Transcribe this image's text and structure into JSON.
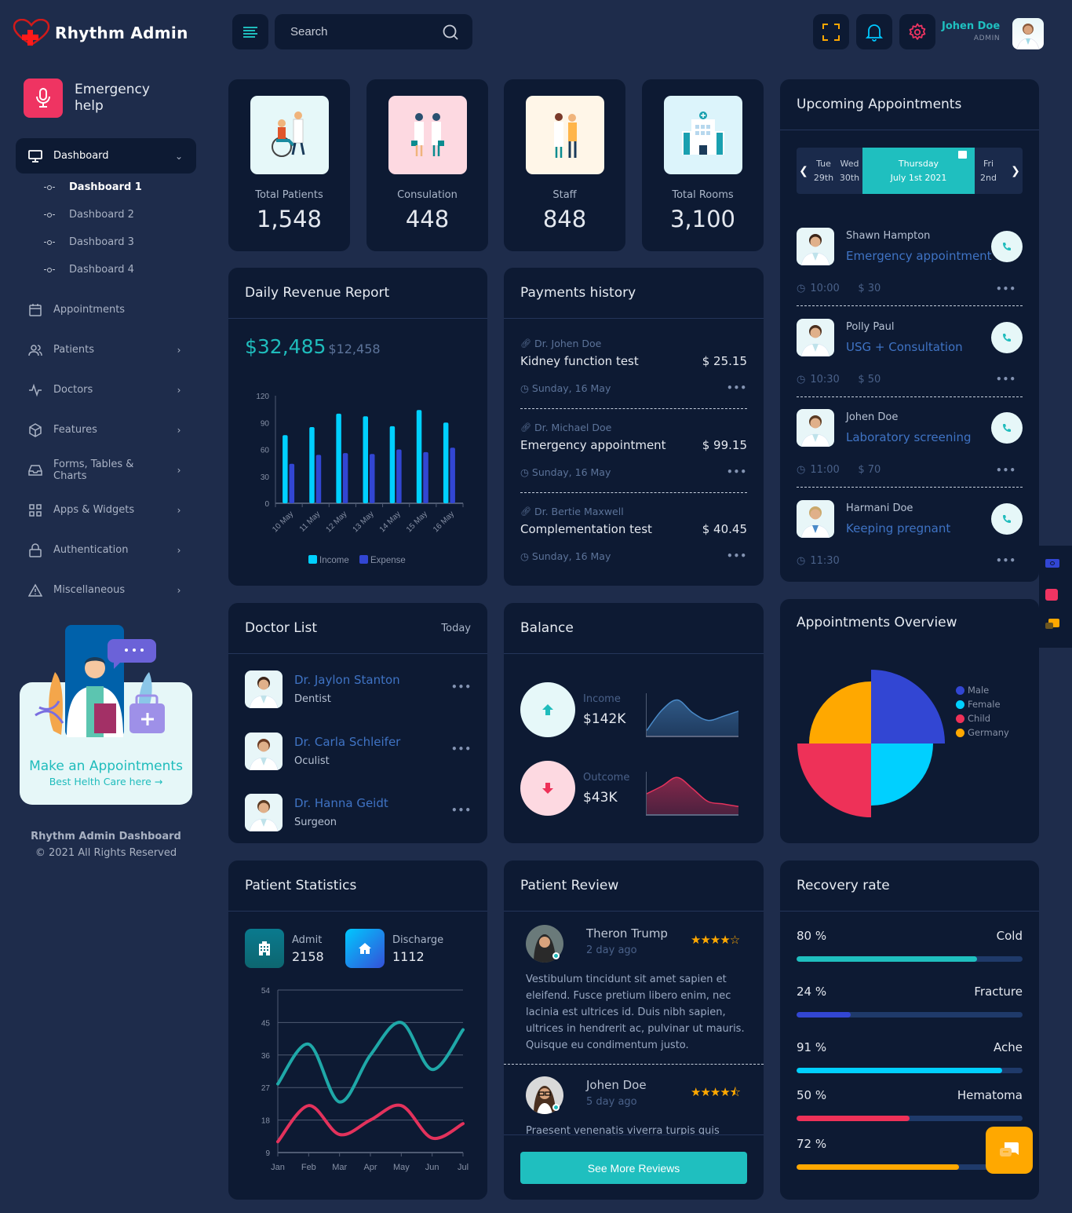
{
  "app": {
    "title": "Rhythm Admin"
  },
  "header": {
    "search_placeholder": "Search",
    "user_name": "Johen Doe",
    "user_role": "ADMIN",
    "icons": [
      "menu-icon",
      "search-icon",
      "fullscreen-icon",
      "bell-icon",
      "gear-icon"
    ]
  },
  "sidebar": {
    "emergency": "Emergency help",
    "dashboard_label": "Dashboard",
    "sub_items": [
      "Dashboard 1",
      "Dashboard 2",
      "Dashboard 3",
      "Dashboard 4"
    ],
    "items": [
      {
        "label": "Appointments",
        "icon": "calendar-icon",
        "has_children": false
      },
      {
        "label": "Patients",
        "icon": "users-icon",
        "has_children": true
      },
      {
        "label": "Doctors",
        "icon": "activity-icon",
        "has_children": true
      },
      {
        "label": "Features",
        "icon": "box-icon",
        "has_children": true
      },
      {
        "label": "Forms, Tables & Charts",
        "icon": "inbox-icon",
        "has_children": true
      },
      {
        "label": "Apps & Widgets",
        "icon": "grid-icon",
        "has_children": true
      },
      {
        "label": "Authentication",
        "icon": "lock-icon",
        "has_children": true
      },
      {
        "label": "Miscellaneous",
        "icon": "alert-triangle-icon",
        "has_children": true
      }
    ],
    "promo_title": "Make an Appointments",
    "promo_link": "Best Helth Care here →",
    "footer_title": "Rhythm Admin Dashboard",
    "footer_copy": "© 2021 All Rights Reserved"
  },
  "stats": [
    {
      "label": "Total Patients",
      "value": "1,548",
      "bg": "#e6f8f9"
    },
    {
      "label": "Consulation",
      "value": "448",
      "bg": "#fdd9e1"
    },
    {
      "label": "Staff",
      "value": "848",
      "bg": "#fff6e8"
    },
    {
      "label": "Total Rooms",
      "value": "3,100",
      "bg": "#dcf4fb"
    }
  ],
  "revenue": {
    "title": "Daily Revenue Report",
    "amount": "$32,485",
    "secondary": "$12,458"
  },
  "payments": {
    "title": "Payments history",
    "items": [
      {
        "doctor": "Dr. Johen Doe",
        "service": "Kidney function test",
        "amount": "$ 25.15",
        "date": "Sunday, 16 May"
      },
      {
        "doctor": "Dr. Michael Doe",
        "service": "Emergency appointment",
        "amount": "$ 99.15",
        "date": "Sunday, 16 May"
      },
      {
        "doctor": "Dr. Bertie Maxwell",
        "service": "Complementation test",
        "amount": "$ 40.45",
        "date": "Sunday, 16 May"
      }
    ]
  },
  "appointments": {
    "title": "Upcoming Appointments",
    "dates": [
      {
        "day": "Tue",
        "date": "29th"
      },
      {
        "day": "Wed",
        "date": "30th"
      },
      {
        "day": "Thursday",
        "date": "July 1st 2021",
        "selected": true
      },
      {
        "day": "Fri",
        "date": "2nd"
      }
    ],
    "items": [
      {
        "name": "Shawn Hampton",
        "type": "Emergency appointment",
        "time": "10:00",
        "price": "$ 30"
      },
      {
        "name": "Polly Paul",
        "type": "USG + Consultation",
        "time": "10:30",
        "price": "$ 50"
      },
      {
        "name": "Johen Doe",
        "type": "Laboratory screening",
        "time": "11:00",
        "price": "$ 70"
      },
      {
        "name": "Harmani Doe",
        "type": "Keeping pregnant",
        "time": "11:30",
        "price": ""
      }
    ]
  },
  "doctor_list": {
    "title": "Doctor List",
    "filter": "Today",
    "items": [
      {
        "name": "Dr. Jaylon Stanton",
        "specialty": "Dentist"
      },
      {
        "name": "Dr. Carla Schleifer",
        "specialty": "Oculist"
      },
      {
        "name": "Dr. Hanna Geidt",
        "specialty": "Surgeon"
      }
    ]
  },
  "balance": {
    "title": "Balance",
    "income_label": "Income",
    "income_value": "$142K",
    "outcome_label": "Outcome",
    "outcome_value": "$43K"
  },
  "overview": {
    "title": "Appointments Overview"
  },
  "patient_stats": {
    "title": "Patient Statistics",
    "admit_label": "Admit",
    "admit_value": "2158",
    "discharge_label": "Discharge",
    "discharge_value": "1112"
  },
  "reviews": {
    "title": "Patient Review",
    "items": [
      {
        "name": "Theron Trump",
        "time": "2 day ago",
        "rating": 4,
        "text": "Vestibulum tincidunt sit amet sapien et eleifend. Fusce pretium libero enim, nec lacinia est ultrices id. Duis nibh sapien, ultrices in hendrerit ac, pulvinar ut mauris. Quisque eu condimentum justo."
      },
      {
        "name": "Johen Doe",
        "time": "5 day ago",
        "rating": 4.5,
        "text": "Praesent venenatis viverra turpis quis"
      }
    ],
    "button": "See More Reviews"
  },
  "recovery": {
    "title": "Recovery rate",
    "items": [
      {
        "label": "Cold",
        "percent_text": "80 %",
        "value": 80,
        "color": "#1fbfbf"
      },
      {
        "label": "Fracture",
        "percent_text": "24 %",
        "value": 24,
        "color": "#3246d3"
      },
      {
        "label": "Ache",
        "percent_text": "91 %",
        "value": 91,
        "color": "#00d0ff"
      },
      {
        "label": "Hematoma",
        "percent_text": "50 %",
        "value": 50,
        "color": "#ee3158"
      },
      {
        "label": "",
        "percent_text": "72 %",
        "value": 72,
        "color": "#ffa800"
      }
    ]
  },
  "chart_data": [
    {
      "type": "bar",
      "title": "Daily Revenue Report",
      "categories": [
        "10 May",
        "11 May",
        "12 May",
        "13 May",
        "14 May",
        "15 May",
        "16 May"
      ],
      "series": [
        {
          "name": "Income",
          "color": "#00d0ff",
          "values": [
            76,
            85,
            100,
            97,
            86,
            104,
            90
          ]
        },
        {
          "name": "Expense",
          "color": "#3246d3",
          "values": [
            44,
            54,
            56,
            55,
            60,
            57,
            62
          ]
        }
      ],
      "yticks": [
        0,
        30,
        60,
        90,
        120
      ],
      "ylim": [
        0,
        120
      ],
      "legend": "bottom"
    },
    {
      "type": "line",
      "title": "Patient Statistics",
      "categories": [
        "Jan",
        "Feb",
        "Mar",
        "Apr",
        "May",
        "Jun",
        "Jul"
      ],
      "series": [
        {
          "name": "Admit",
          "color": "#1fa8a8",
          "values": [
            28,
            39,
            23,
            36,
            45,
            32,
            43
          ]
        },
        {
          "name": "Discharge",
          "color": "#e3325c",
          "values": [
            12,
            22,
            14,
            18,
            22,
            13,
            17
          ]
        }
      ],
      "yticks": [
        9,
        18,
        27,
        36,
        45,
        54
      ],
      "ylim": [
        9,
        54
      ],
      "grid": true
    },
    {
      "type": "pie",
      "title": "Appointments Overview",
      "labels": [
        "Male",
        "Female",
        "Child",
        "Germany"
      ],
      "colors": [
        "#3246d3",
        "#00d0ff",
        "#ee3158",
        "#ffa800"
      ],
      "values": [
        25,
        25,
        25,
        25
      ],
      "radii": [
        94,
        79,
        94,
        79
      ],
      "legend": "right"
    },
    {
      "type": "area",
      "title": "Balance Income",
      "values": [
        10,
        50,
        70,
        45,
        30,
        38,
        48
      ],
      "color": "#4a8ac8"
    },
    {
      "type": "area",
      "title": "Balance Outcome",
      "values": [
        40,
        55,
        72,
        50,
        25,
        20,
        15
      ],
      "color": "#e3325c"
    }
  ]
}
